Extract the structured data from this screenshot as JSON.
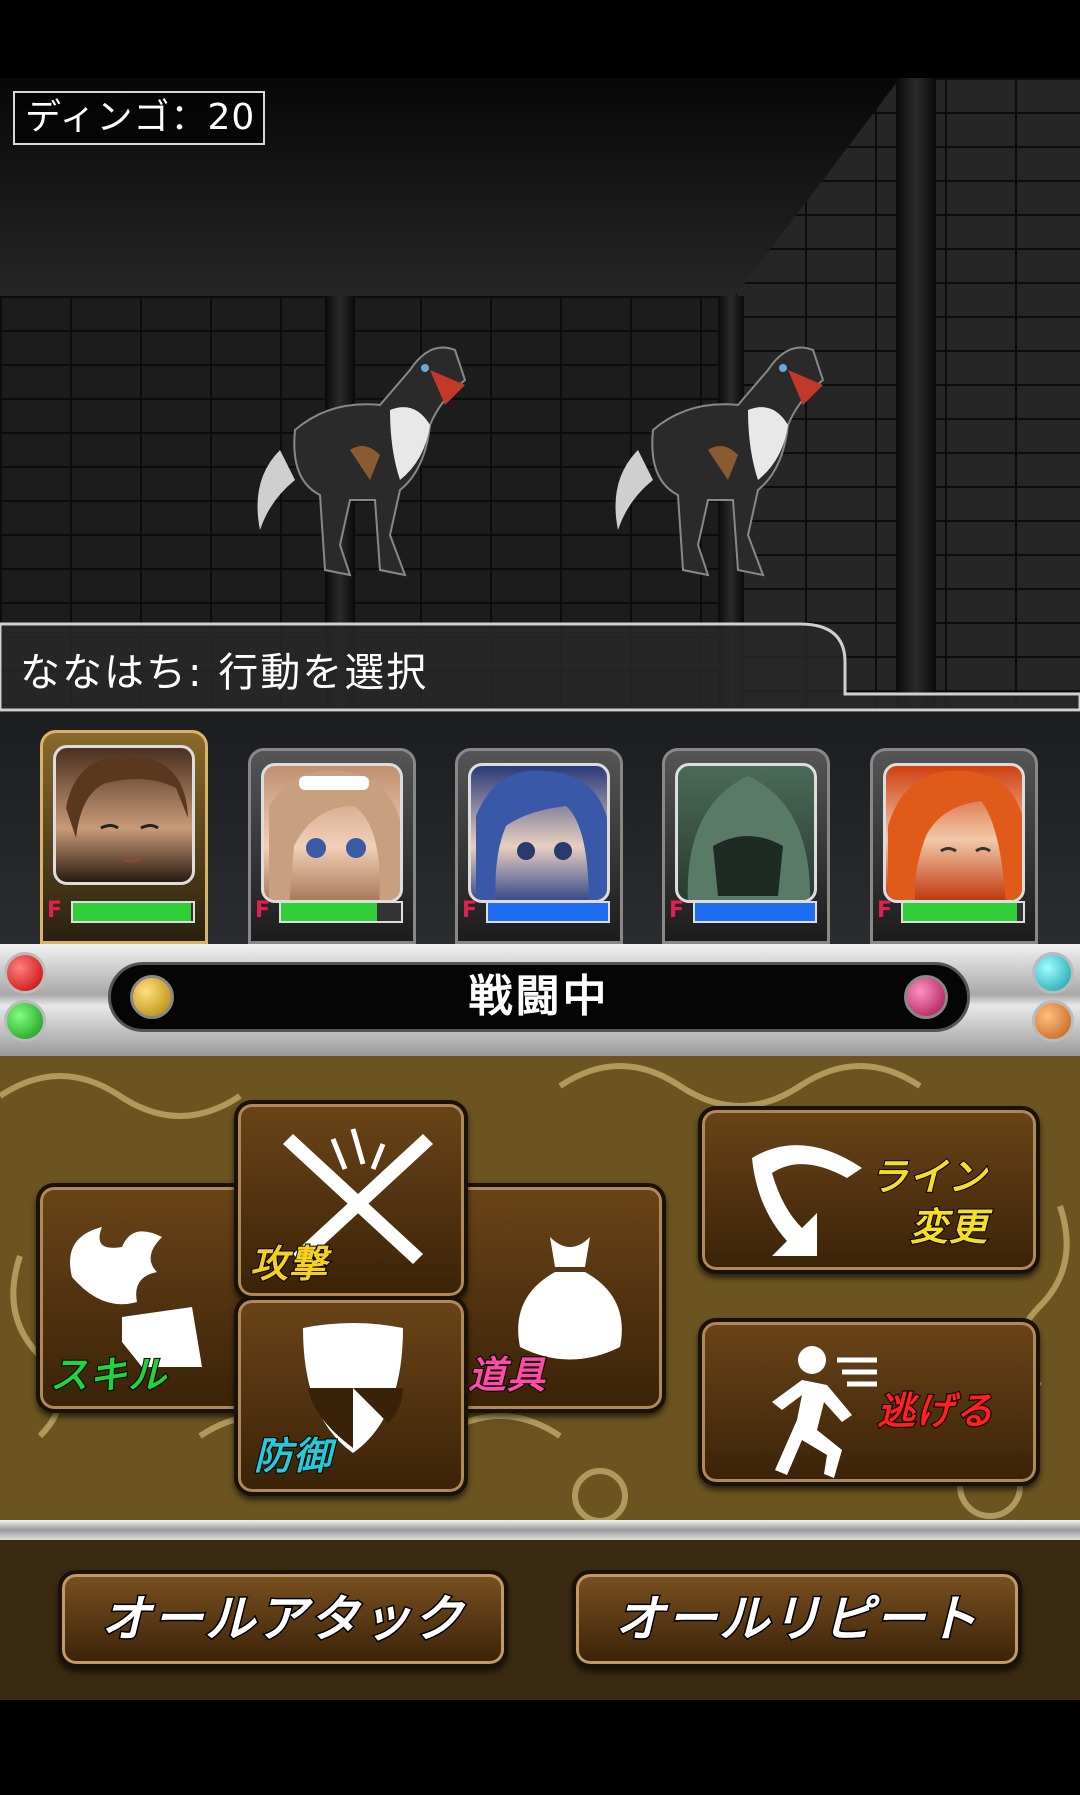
{
  "enemy_group": {
    "label": "ディンゴ：20"
  },
  "message": "ななはち: 行動を選択",
  "party": [
    {
      "name": "member-1",
      "hp": 0.98,
      "bar_color": "#2fcf3a",
      "active": true
    },
    {
      "name": "member-2",
      "hp": 0.8,
      "bar_color": "#2fcf3a",
      "active": false
    },
    {
      "name": "member-3",
      "hp": 1.0,
      "bar_color": "#1e6cf0",
      "active": false
    },
    {
      "name": "member-4",
      "hp": 1.0,
      "bar_color": "#1e6cf0",
      "active": false
    },
    {
      "name": "member-5",
      "hp": 0.95,
      "bar_color": "#2fcf3a",
      "active": false
    }
  ],
  "party_hp_mark": "F",
  "status": {
    "text": "戦闘中"
  },
  "commands": {
    "attack": "攻撃",
    "skill": "スキル",
    "defend": "防御",
    "item": "道具",
    "line_change_1": "ライン",
    "line_change_2": "変更",
    "escape": "逃げる"
  },
  "bottom": {
    "all_attack": "オールアタック",
    "all_repeat": "オールリピート"
  },
  "colors": {
    "attack": "#f5d020",
    "skill": "#22d43a",
    "defend": "#27c8d8",
    "item": "#ff4aa8",
    "line": "#f5e020",
    "escape": "#ff2020"
  }
}
